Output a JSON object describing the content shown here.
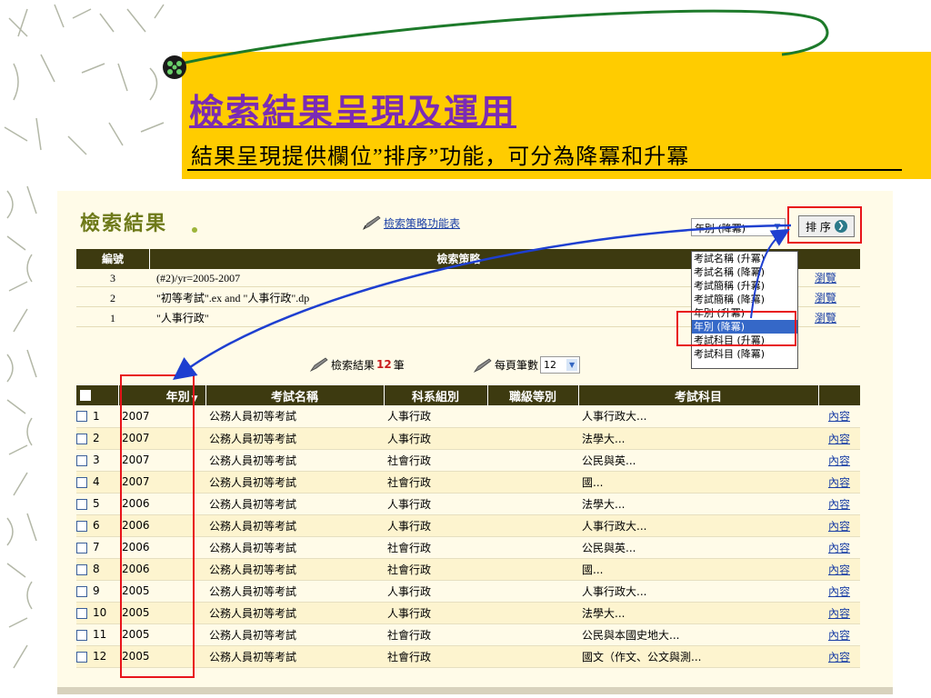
{
  "slide": {
    "title": "檢索結果呈現及運用",
    "subtitle": "結果呈現提供欄位”排序”功能，可分為降冪和升冪"
  },
  "colors": {
    "band": "#ffcc00",
    "title": "#7a2bb5",
    "highlight": "#e8141b",
    "arrow": "#1e3fd0"
  },
  "panel": {
    "results_title": "檢索結果",
    "strategy_link": "檢索策略功能表",
    "sort_select": {
      "value": "年別 (降冪)"
    },
    "sort_button": "排 序",
    "strategy_table": {
      "headers": [
        "編號",
        "檢索策略"
      ],
      "rows": [
        {
          "num": "3",
          "query": "(#2)/yr=2005-2007",
          "view": "瀏覽"
        },
        {
          "num": "2",
          "query": "\"初等考試\".ex and \"人事行政\".dp",
          "view": "瀏覽"
        },
        {
          "num": "1",
          "query": "\"人事行政\"",
          "view": "瀏覽"
        }
      ]
    },
    "dropdown_options": [
      "考試名稱 (升冪)",
      "考試名稱 (降冪)",
      "考試簡稱 (升冪)",
      "考試簡稱 (降冪)",
      "年別 (升冪)",
      "年別 (降冪)",
      "考試科目 (升冪)",
      "考試科目 (降冪)"
    ],
    "dropdown_selected": "年別 (降冪)",
    "count": {
      "prefix": "檢索結果",
      "value": "12",
      "suffix": "筆"
    },
    "per_page": {
      "label": "每頁筆數",
      "value": "12"
    },
    "results_table": {
      "headers": [
        "",
        "年別",
        "考試名稱",
        "科系組別",
        "職級等別",
        "考試科目",
        ""
      ],
      "rows": [
        {
          "n": "1",
          "year": "2007",
          "exam": "公務人員初等考試",
          "dept": "人事行政",
          "grade": "",
          "subject": "人事行政大...",
          "link": "內容"
        },
        {
          "n": "2",
          "year": "2007",
          "exam": "公務人員初等考試",
          "dept": "人事行政",
          "grade": "",
          "subject": "法學大...",
          "link": "內容"
        },
        {
          "n": "3",
          "year": "2007",
          "exam": "公務人員初等考試",
          "dept": "社會行政",
          "grade": "",
          "subject": "公民與英...",
          "link": "內容"
        },
        {
          "n": "4",
          "year": "2007",
          "exam": "公務人員初等考試",
          "dept": "社會行政",
          "grade": "",
          "subject": "國...",
          "link": "內容"
        },
        {
          "n": "5",
          "year": "2006",
          "exam": "公務人員初等考試",
          "dept": "人事行政",
          "grade": "",
          "subject": "法學大...",
          "link": "內容"
        },
        {
          "n": "6",
          "year": "2006",
          "exam": "公務人員初等考試",
          "dept": "人事行政",
          "grade": "",
          "subject": "人事行政大...",
          "link": "內容"
        },
        {
          "n": "7",
          "year": "2006",
          "exam": "公務人員初等考試",
          "dept": "社會行政",
          "grade": "",
          "subject": "公民與英...",
          "link": "內容"
        },
        {
          "n": "8",
          "year": "2006",
          "exam": "公務人員初等考試",
          "dept": "社會行政",
          "grade": "",
          "subject": "國...",
          "link": "內容"
        },
        {
          "n": "9",
          "year": "2005",
          "exam": "公務人員初等考試",
          "dept": "人事行政",
          "grade": "",
          "subject": "人事行政大...",
          "link": "內容"
        },
        {
          "n": "10",
          "year": "2005",
          "exam": "公務人員初等考試",
          "dept": "人事行政",
          "grade": "",
          "subject": "法學大...",
          "link": "內容"
        },
        {
          "n": "11",
          "year": "2005",
          "exam": "公務人員初等考試",
          "dept": "社會行政",
          "grade": "",
          "subject": "公民與本國史地大...",
          "link": "內容"
        },
        {
          "n": "12",
          "year": "2005",
          "exam": "公務人員初等考試",
          "dept": "社會行政",
          "grade": "",
          "subject": "國文（作文、公文與測...",
          "link": "內容"
        }
      ]
    }
  }
}
